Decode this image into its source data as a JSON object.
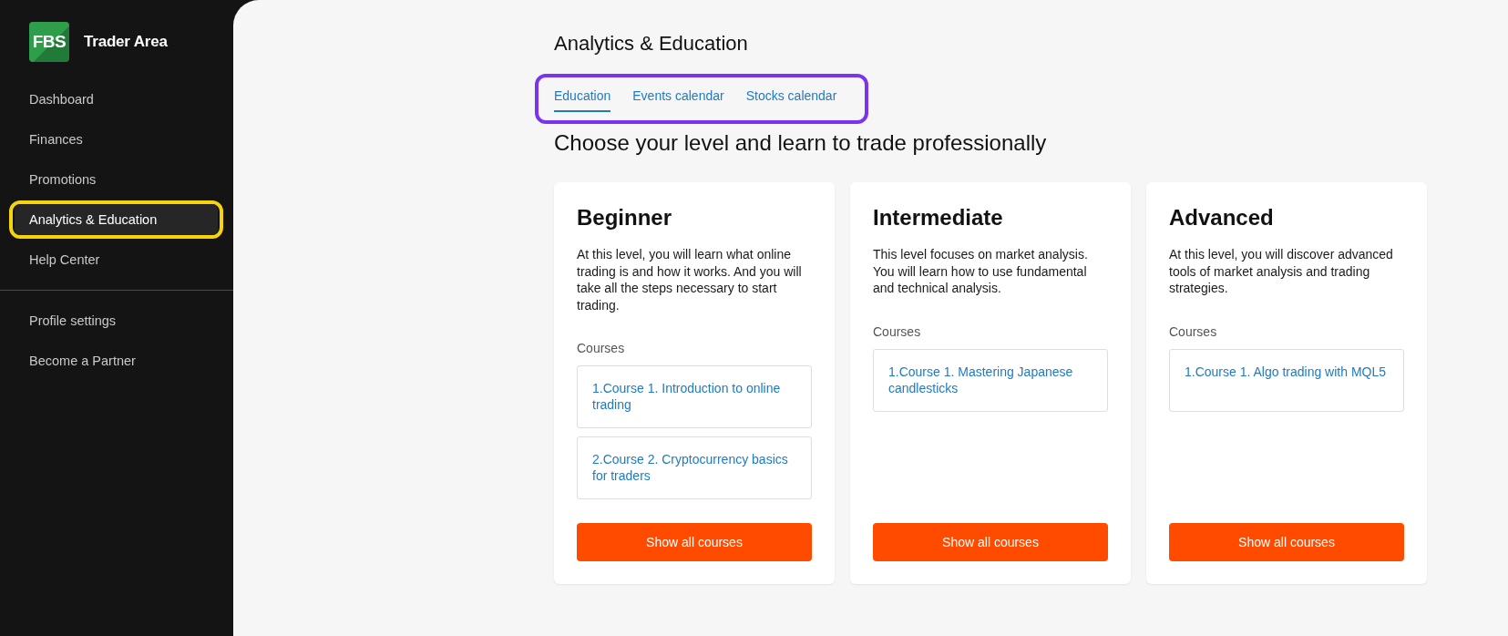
{
  "sidebar": {
    "logo_mark": "FBS",
    "title": "Trader Area",
    "items": [
      {
        "label": "Dashboard",
        "selected": false,
        "highlighted": false
      },
      {
        "label": "Finances",
        "selected": false,
        "highlighted": false
      },
      {
        "label": "Promotions",
        "selected": false,
        "highlighted": false
      },
      {
        "label": "Analytics & Education",
        "selected": true,
        "highlighted": true
      },
      {
        "label": "Help Center",
        "selected": false,
        "highlighted": false
      }
    ],
    "account_items": [
      {
        "label": "Profile settings",
        "selected": false
      },
      {
        "label": "Become a Partner",
        "selected": false
      }
    ]
  },
  "main": {
    "title": "Analytics & Education",
    "tab_bar": {
      "highlighted": true,
      "tabs": [
        {
          "label": "Education",
          "selected": true
        },
        {
          "label": "Events calendar",
          "selected": false
        },
        {
          "label": "Stocks calendar",
          "selected": false
        }
      ]
    },
    "heading": "Choose your level and learn to trade professionally",
    "levels": [
      {
        "title": "Beginner",
        "description": "At this level, you will learn what online trading is and how it works. And you will take all the steps necessary to start trading.",
        "courses_label": "Courses",
        "courses": [
          "1.Course 1. Introduction to online trading",
          "2.Course 2. Cryptocurrency basics for traders"
        ],
        "button": "Show all courses"
      },
      {
        "title": "Intermediate",
        "description": "This level focuses on market analysis. You will learn how to use fundamental and technical analysis.",
        "courses_label": "Courses",
        "courses": [
          "1.Course 1. Mastering Japanese candlesticks"
        ],
        "button": "Show all courses"
      },
      {
        "title": "Advanced",
        "description": "At this level, you will discover advanced tools of market analysis and trading strategies.",
        "courses_label": "Courses",
        "courses": [
          "1.Course 1. Algo trading with MQL5"
        ],
        "button": "Show all courses"
      }
    ]
  }
}
